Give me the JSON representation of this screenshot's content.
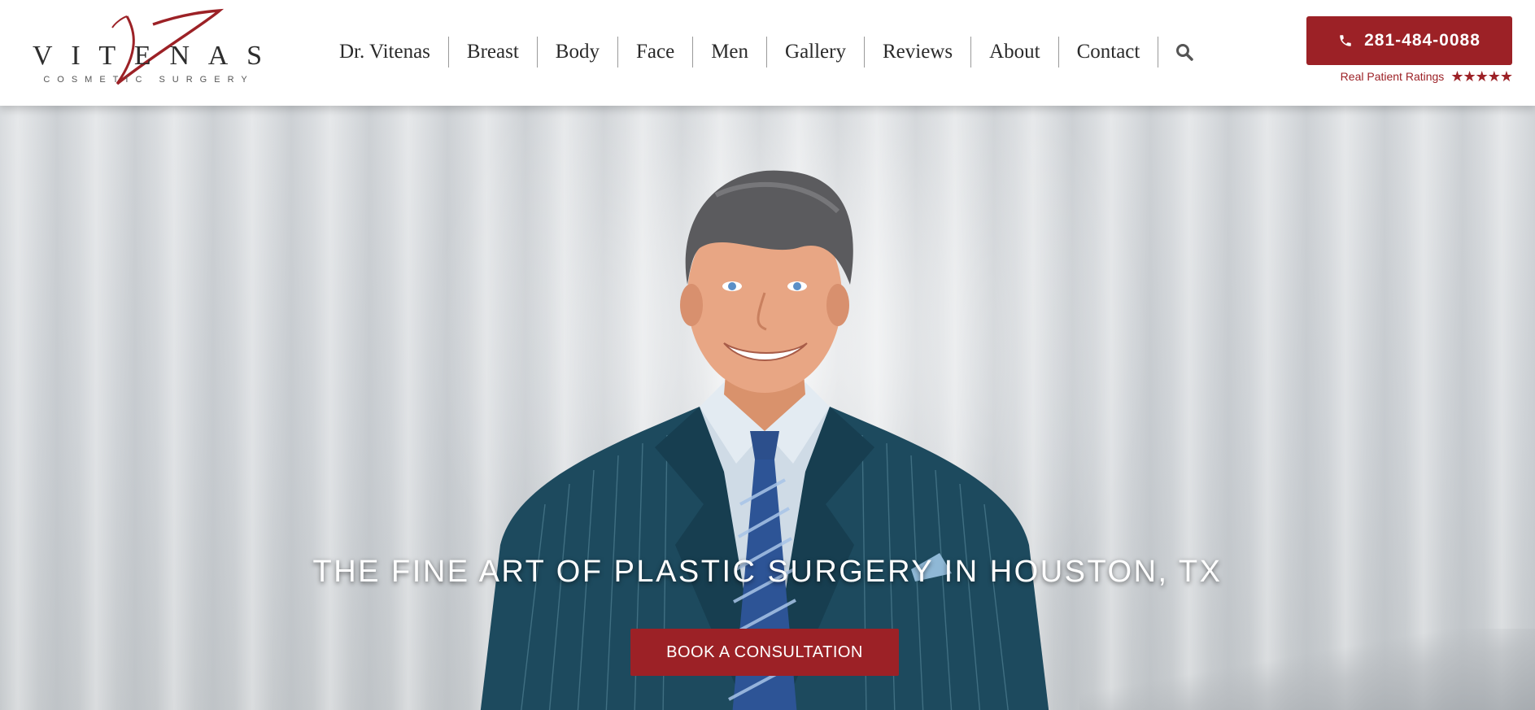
{
  "brand": {
    "logo_letters": [
      "V",
      "I",
      "T",
      "E",
      "N",
      "A",
      "S"
    ],
    "logo_subtitle": "COSMETIC SURGERY",
    "accent_color": "#9c2126"
  },
  "nav": {
    "items": [
      {
        "label": "Dr. Vitenas"
      },
      {
        "label": "Breast"
      },
      {
        "label": "Body"
      },
      {
        "label": "Face"
      },
      {
        "label": "Men"
      },
      {
        "label": "Gallery"
      },
      {
        "label": "Reviews"
      },
      {
        "label": "About"
      },
      {
        "label": "Contact"
      }
    ],
    "search_icon": "search-icon"
  },
  "contact": {
    "phone_icon": "phone-icon",
    "phone": "281-484-0088",
    "ratings_label": "Real Patient Ratings",
    "stars": "★★★★★",
    "rating_value": 5
  },
  "hero": {
    "tagline": "THE FINE ART OF PLASTIC SURGERY IN HOUSTON, TX",
    "cta_label": "BOOK A CONSULTATION"
  }
}
